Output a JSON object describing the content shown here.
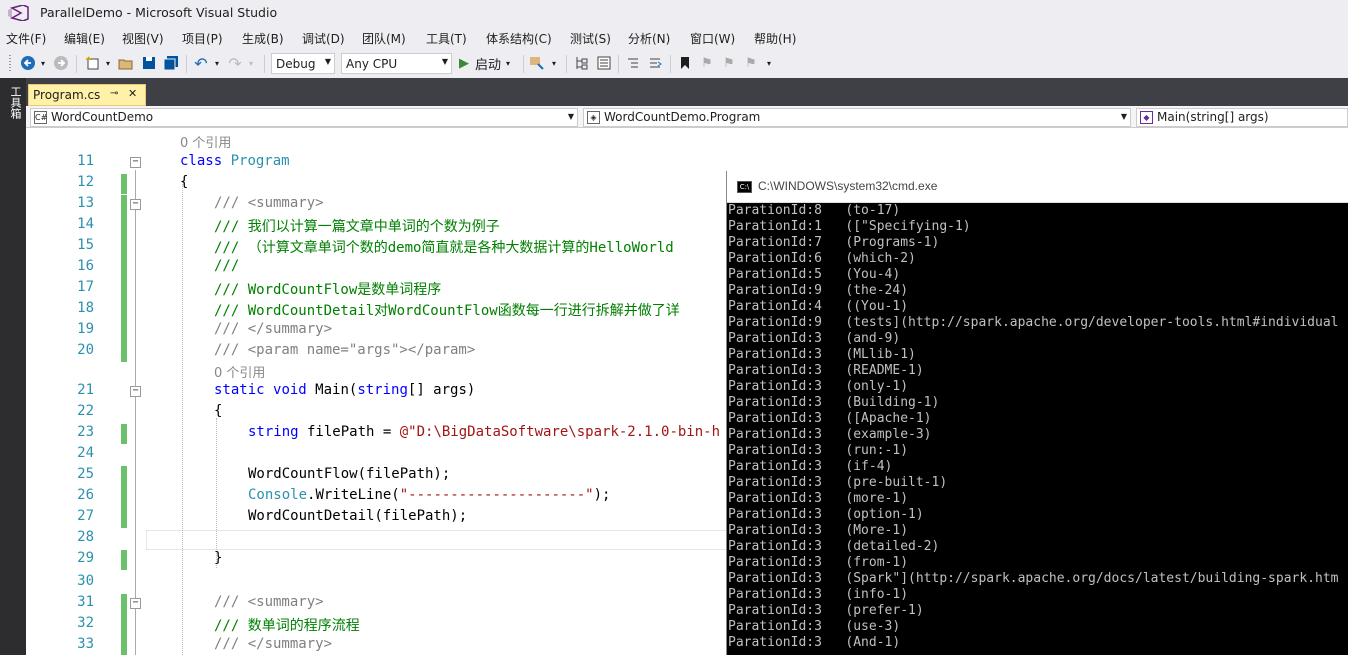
{
  "window": {
    "title": "ParallelDemo - Microsoft Visual Studio"
  },
  "menu": [
    "文件(F)",
    "编辑(E)",
    "视图(V)",
    "项目(P)",
    "生成(B)",
    "调试(D)",
    "团队(M)",
    "工具(T)",
    "体系结构(C)",
    "测试(S)",
    "分析(N)",
    "窗口(W)",
    "帮助(H)"
  ],
  "toolbar": {
    "config": "Debug",
    "platform": "Any CPU",
    "start_label": "启动"
  },
  "side_tab": "工具箱",
  "doc_tab": {
    "label": "Program.cs"
  },
  "nav": {
    "project": "WordCountDemo",
    "class": "WordCountDemo.Program",
    "member": "Main(string[] args)"
  },
  "editor": {
    "ref_class": "0 个引用",
    "ref_main": "0 个引用",
    "line_numbers": [
      "11",
      "12",
      "13",
      "14",
      "15",
      "16",
      "17",
      "18",
      "19",
      "20",
      "21",
      "22",
      "23",
      "24",
      "25",
      "26",
      "27",
      "28",
      "29",
      "30",
      "31",
      "32",
      "33"
    ],
    "lines": {
      "l11_kw": "class",
      "l11_ty": "Program",
      "l12": "{",
      "l13_a": "/// ",
      "l13_b": "<summary>",
      "l14": "/// 我们以计算一篇文章中单词的个数为例子",
      "l15": "/// （计算文章单词个数的demo简直就是各种大数据计算的HelloWorld",
      "l16": "///",
      "l17": "/// WordCountFlow是数单词程序",
      "l18": "/// WordCountDetail对WordCountFlow函数每一行进行拆解并做了详",
      "l19_a": "/// ",
      "l19_b": "</summary>",
      "l20_a": "/// ",
      "l20_b": "<param name=\"args\"></param>",
      "l21_kw1": "static",
      "l21_kw2": "void",
      "l21_name": " Main(",
      "l21_kw3": "string",
      "l21_rest": "[] args)",
      "l22": "{",
      "l23_kw": "string",
      "l23_mid": " filePath = ",
      "l23_st": "@\"D:\\BigDataSoftware\\spark-2.1.0-bin-h",
      "l25": "WordCountFlow(filePath);",
      "l26_ty": "Console",
      "l26_mid": ".WriteLine(",
      "l26_st": "\"---------------------\"",
      "l26_end": ");",
      "l27": "WordCountDetail(filePath);",
      "l29": "}",
      "l31_a": "/// ",
      "l31_b": "<summary>",
      "l32": "/// 数单词的程序流程",
      "l33_a": "/// ",
      "l33_b": "</summary>"
    }
  },
  "cmd": {
    "title": "C:\\WINDOWS\\system32\\cmd.exe",
    "rows": [
      [
        "ParationId:8",
        "(to-17)"
      ],
      [
        "ParationId:1",
        "([\"Specifying-1)"
      ],
      [
        "ParationId:7",
        "(Programs-1)"
      ],
      [
        "ParationId:6",
        "(which-2)"
      ],
      [
        "ParationId:5",
        "(You-4)"
      ],
      [
        "ParationId:9",
        "(the-24)"
      ],
      [
        "ParationId:4",
        "((You-1)"
      ],
      [
        "ParationId:9",
        "(tests](http://spark.apache.org/developer-tools.html#individual"
      ],
      [
        "ParationId:3",
        "(and-9)"
      ],
      [
        "ParationId:3",
        "(MLlib-1)"
      ],
      [
        "ParationId:3",
        "(README-1)"
      ],
      [
        "ParationId:3",
        "(only-1)"
      ],
      [
        "ParationId:3",
        "(Building-1)"
      ],
      [
        "ParationId:3",
        "([Apache-1)"
      ],
      [
        "ParationId:3",
        "(example-3)"
      ],
      [
        "ParationId:3",
        "(run:-1)"
      ],
      [
        "ParationId:3",
        "(if-4)"
      ],
      [
        "ParationId:3",
        "(pre-built-1)"
      ],
      [
        "ParationId:3",
        "(more-1)"
      ],
      [
        "ParationId:3",
        "(option-1)"
      ],
      [
        "ParationId:3",
        "(More-1)"
      ],
      [
        "ParationId:3",
        "(detailed-2)"
      ],
      [
        "ParationId:3",
        "(from-1)"
      ],
      [
        "ParationId:3",
        "(Spark\"](http://spark.apache.org/docs/latest/building-spark.htm"
      ],
      [
        "ParationId:3",
        "(info-1)"
      ],
      [
        "ParationId:3",
        "(prefer-1)"
      ],
      [
        "ParationId:3",
        "(use-3)"
      ],
      [
        "ParationId:3",
        "(And-1)"
      ]
    ]
  }
}
